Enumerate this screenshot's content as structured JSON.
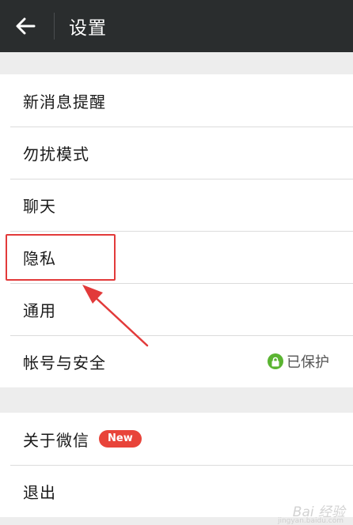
{
  "header": {
    "title": "设置",
    "back_icon": "arrow-left-icon"
  },
  "settings": {
    "group1": [
      {
        "label": "新消息提醒"
      },
      {
        "label": "勿扰模式"
      },
      {
        "label": "聊天"
      },
      {
        "label": "隐私"
      },
      {
        "label": "通用"
      },
      {
        "label": "帐号与安全",
        "status": "已保护",
        "status_icon": "lock-icon"
      }
    ],
    "group2": [
      {
        "label": "关于微信",
        "badge": "New"
      },
      {
        "label": "退出"
      }
    ]
  },
  "annotation": {
    "highlight_color": "#e23a3a"
  },
  "watermark": {
    "text": "Bai 经验",
    "sub": "jingyan.baidu.com"
  },
  "colors": {
    "header_bg": "#2a2d2e",
    "accent_green": "#5ab431",
    "badge_red": "#e8443a"
  }
}
